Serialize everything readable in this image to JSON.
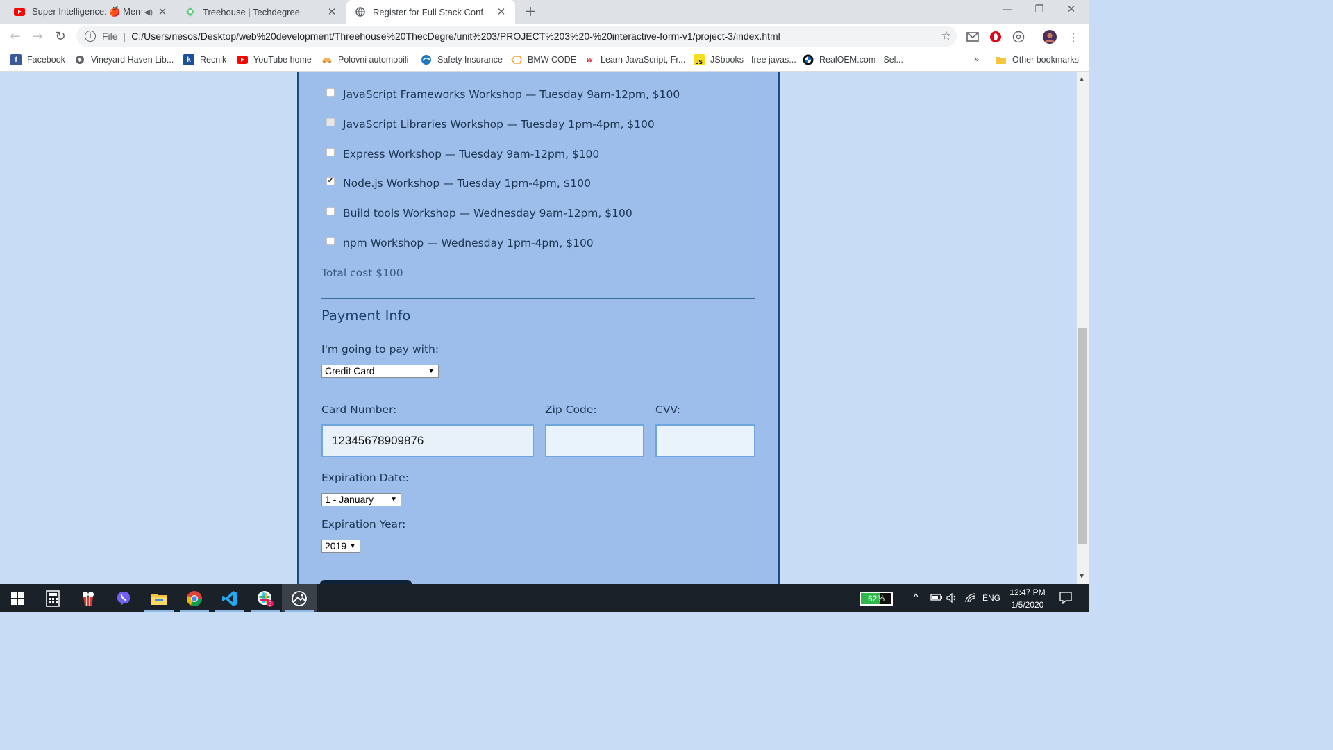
{
  "browser": {
    "tabs": [
      {
        "title": "Super Intelligence: 🍎 Memo",
        "icon": "youtube-icon",
        "audio": true
      },
      {
        "title": "Treehouse | Techdegree",
        "icon": "treehouse-icon"
      },
      {
        "title": "Register for Full Stack Conf",
        "icon": "globe-icon",
        "active": true
      }
    ],
    "address": {
      "scheme": "File",
      "url": "C:/Users/nesos/Desktop/web%20development/Threehouse%20ThecDegre/unit%203/PROJECT%203%20-%20interactive-form-v1/project-3/index.html"
    },
    "bookmarks": [
      {
        "label": "Facebook",
        "icon": "facebook-icon"
      },
      {
        "label": "Vineyard Haven Lib...",
        "icon": "globe-icon"
      },
      {
        "label": "Recnik",
        "icon": "k-icon"
      },
      {
        "label": "YouTube home",
        "icon": "youtube-icon"
      },
      {
        "label": "Polovni automobili",
        "icon": "car-icon"
      },
      {
        "label": "Safety Insurance",
        "icon": "insurance-icon"
      },
      {
        "label": "BMW CODE",
        "icon": "code-icon"
      },
      {
        "label": "Learn JavaScript, Fr...",
        "icon": "w3-icon"
      },
      {
        "label": "JSbooks - free javas...",
        "icon": "js-icon"
      },
      {
        "label": "RealOEM.com - Sel...",
        "icon": "bmw-icon"
      }
    ],
    "more_bookmarks": "»",
    "other_bookmarks": "Other bookmarks"
  },
  "form": {
    "activities": [
      {
        "label": "JavaScript Frameworks Workshop — Tuesday 9am-12pm, $100",
        "checked": false
      },
      {
        "label": "JavaScript Libraries Workshop — Tuesday 1pm-4pm, $100",
        "checked": false
      },
      {
        "label": "Express Workshop — Tuesday 9am-12pm, $100",
        "checked": false
      },
      {
        "label": "Node.js Workshop — Tuesday 1pm-4pm, $100",
        "checked": true
      },
      {
        "label": "Build tools Workshop — Wednesday 9am-12pm, $100",
        "checked": false
      },
      {
        "label": "npm Workshop — Wednesday 1pm-4pm, $100",
        "checked": false
      }
    ],
    "total": "Total cost $100",
    "payment": {
      "heading": "Payment Info",
      "pay_with_label": "I'm going to pay with:",
      "pay_with_value": "Credit Card",
      "card_number_label": "Card Number:",
      "card_number_value": "12345678909876",
      "zip_label": "Zip Code:",
      "zip_value": "",
      "cvv_label": "CVV:",
      "cvv_value": "",
      "exp_date_label": "Expiration Date:",
      "exp_date_value": "1 - January",
      "exp_year_label": "Expiration Year:",
      "exp_year_value": "2019"
    }
  },
  "taskbar": {
    "battery_percent": "62%",
    "battery_level": 0.62,
    "language": "ENG",
    "time": "12:47 PM",
    "date": "1/5/2020"
  },
  "colors": {
    "page_bg": "#c9dcf6",
    "form_bg": "#9dbeeb",
    "form_border": "#1c4d7a",
    "heading": "#1a4167",
    "input_border": "#6ea4e0"
  }
}
